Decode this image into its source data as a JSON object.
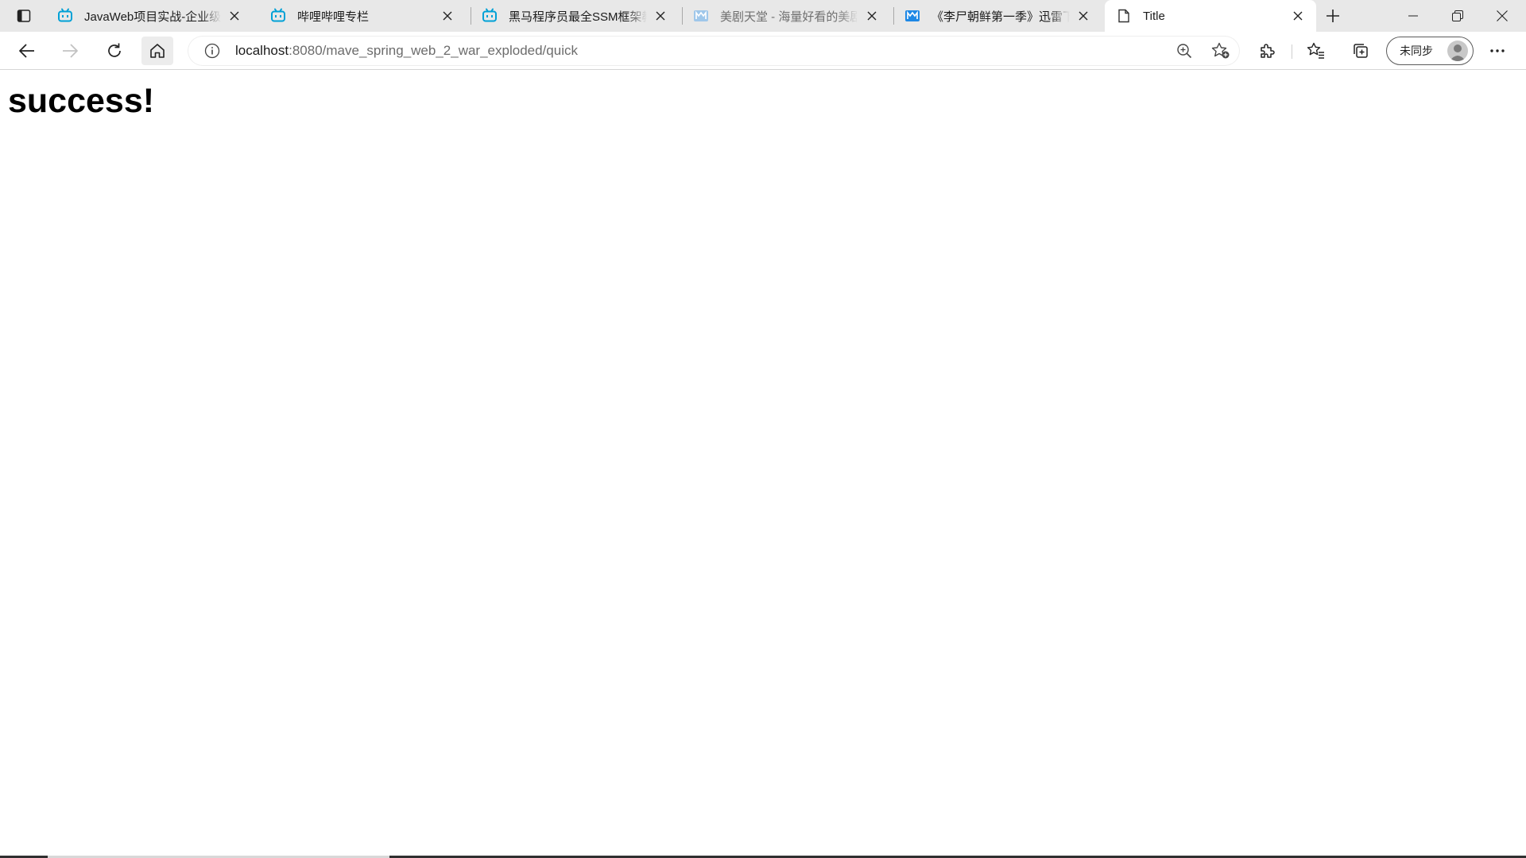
{
  "browser": {
    "tabs": [
      {
        "title": "JavaWeb项目实战-企业级CRM客户关系管理系统",
        "favicon": "bilibili-icon",
        "dim": false,
        "active": false
      },
      {
        "title": "哔哩哔哩专栏",
        "favicon": "bilibili-icon",
        "dim": false,
        "active": false
      },
      {
        "title": "黑马程序员最全SSM框架教程",
        "favicon": "bilibili-icon",
        "dim": false,
        "active": false
      },
      {
        "title": "美剧天堂 - 海量好看的美剧在线观看",
        "favicon": "meijutt-icon",
        "dim": true,
        "active": false
      },
      {
        "title": "《李尸朝鲜第一季》迅雷下载",
        "favicon": "meijutt-icon",
        "dim": false,
        "active": true
      },
      {
        "title": "Title",
        "favicon": "page-icon",
        "dim": false,
        "active": true
      }
    ],
    "address": {
      "host": "localhost",
      "rest": ":8080/mave_spring_web_2_war_exploded/quick"
    },
    "profile": {
      "label": "未同步"
    },
    "colors": {
      "bilibili": "#00a1d6",
      "meijutt": "#1e88e5"
    }
  },
  "page": {
    "heading": "success!"
  }
}
